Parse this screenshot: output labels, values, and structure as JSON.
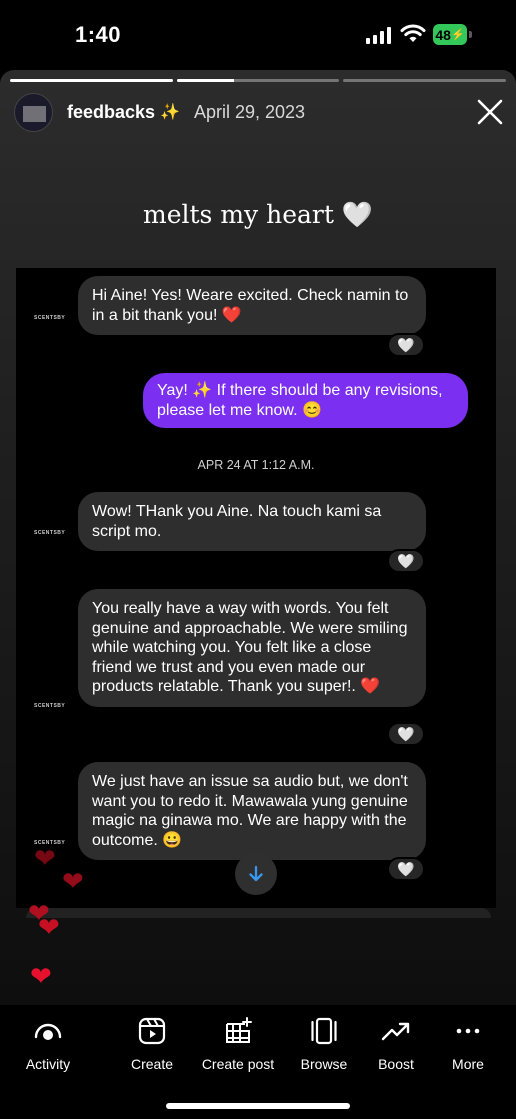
{
  "status_bar": {
    "time": "1:40",
    "battery": "48"
  },
  "story": {
    "progress": [
      1,
      0.35,
      0
    ],
    "username": "feedbacks",
    "sparkle": "✨",
    "date": "April 29, 2023",
    "caption": "melts my heart 🤍"
  },
  "chat": {
    "brand": "SCENTSBY",
    "messages": [
      {
        "from": "them",
        "text": "Hi Aine! Yes! Weare excited. Check namin to in a bit thank you! ❤️",
        "liked": true
      },
      {
        "from": "me",
        "text": "Yay! ✨ If there should be any revisions, please let me know. 😊"
      },
      {
        "from": "them",
        "text": "Wow! THank you Aine. Na touch kami sa script mo.",
        "liked": true
      },
      {
        "from": "them",
        "text": "You really have a way with words. You felt genuine and approachable. We were smiling while watching you. You felt like a close friend we trust and you even made our products relatable. Thank you super!. ❤️",
        "liked": true
      },
      {
        "from": "them",
        "text": "We just have an issue sa audio but, we don't want you to redo it. Mawawala yung genuine magic na ginawa mo. We are happy with the outcome. 😀",
        "liked": true
      }
    ],
    "timestamp": "APR 24 AT 1:12 A.M.",
    "like_icon": "white-heart"
  },
  "bottom_nav": [
    {
      "label": "Activity",
      "icon": "activity-eye-icon"
    },
    {
      "label": "Create",
      "icon": "reels-icon"
    },
    {
      "label": "Create post",
      "icon": "grid-plus-icon"
    },
    {
      "label": "Browse",
      "icon": "browse-icon"
    },
    {
      "label": "Boost",
      "icon": "trend-up-icon"
    },
    {
      "label": "More",
      "icon": "more-icon"
    }
  ],
  "colors": {
    "outgoing_bubble": "#7b2ff0",
    "incoming_bubble": "#2e2e2e",
    "battery": "#34c759",
    "heart": "#e8112d",
    "scroll_arrow": "#3a97f0"
  }
}
